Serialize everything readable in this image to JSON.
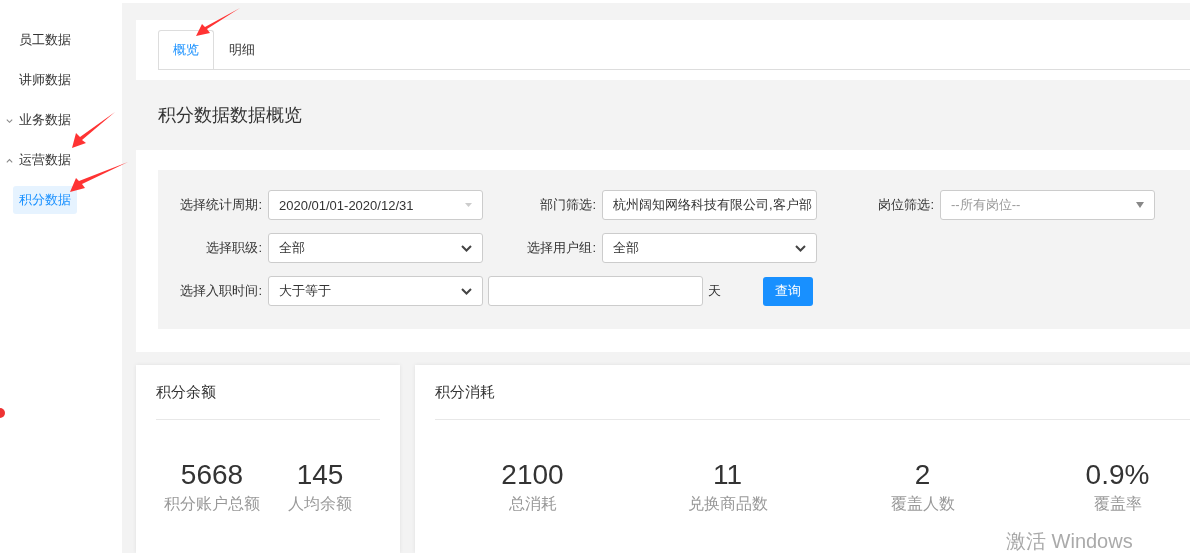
{
  "sidebar": {
    "items": [
      {
        "kind": "item",
        "label": "员工数据",
        "selected": false
      },
      {
        "kind": "item",
        "label": "讲师数据",
        "selected": false
      },
      {
        "kind": "group",
        "label": "业务数据",
        "expanded": false
      },
      {
        "kind": "group",
        "label": "运营数据",
        "expanded": true,
        "children": [
          {
            "kind": "item",
            "label": "积分数据",
            "selected": true
          }
        ]
      }
    ]
  },
  "tabs": [
    {
      "label": "概览",
      "selected": true
    },
    {
      "label": "明细",
      "selected": false
    }
  ],
  "page_title": "积分数据数据概览",
  "filters": [
    {
      "kind": "date",
      "label": "选择统计周期:",
      "value": "2020/01/01-2020/12/31"
    },
    {
      "kind": "text",
      "label": "部门筛选:",
      "value": "杭州阔知网络科技有限公司,客户部"
    },
    {
      "kind": "combo",
      "label": "岗位筛选:",
      "placeholder": "--所有岗位--"
    },
    {
      "kind": "select",
      "label": "选择职级:",
      "value": "全部"
    },
    {
      "kind": "select",
      "label": "选择用户组:",
      "value": "全部"
    },
    {
      "kind": "break"
    },
    {
      "kind": "select",
      "label": "选择入职时间:",
      "value": "大于等于"
    },
    {
      "kind": "number",
      "unit": "天"
    },
    {
      "kind": "button",
      "label": "查询"
    }
  ],
  "cards": [
    {
      "title": "积分余额",
      "stats": [
        {
          "value": "5668",
          "label": "积分账户总额"
        },
        {
          "value": "145",
          "label": "人均余额"
        }
      ]
    },
    {
      "title": "积分消耗",
      "stats": [
        {
          "value": "2100",
          "label": "总消耗"
        },
        {
          "value": "11",
          "label": "兑换商品数"
        },
        {
          "value": "2",
          "label": "覆盖人数"
        },
        {
          "value": "0.9%",
          "label": "覆盖率"
        }
      ]
    }
  ],
  "windows_notice": "激活 Windows"
}
